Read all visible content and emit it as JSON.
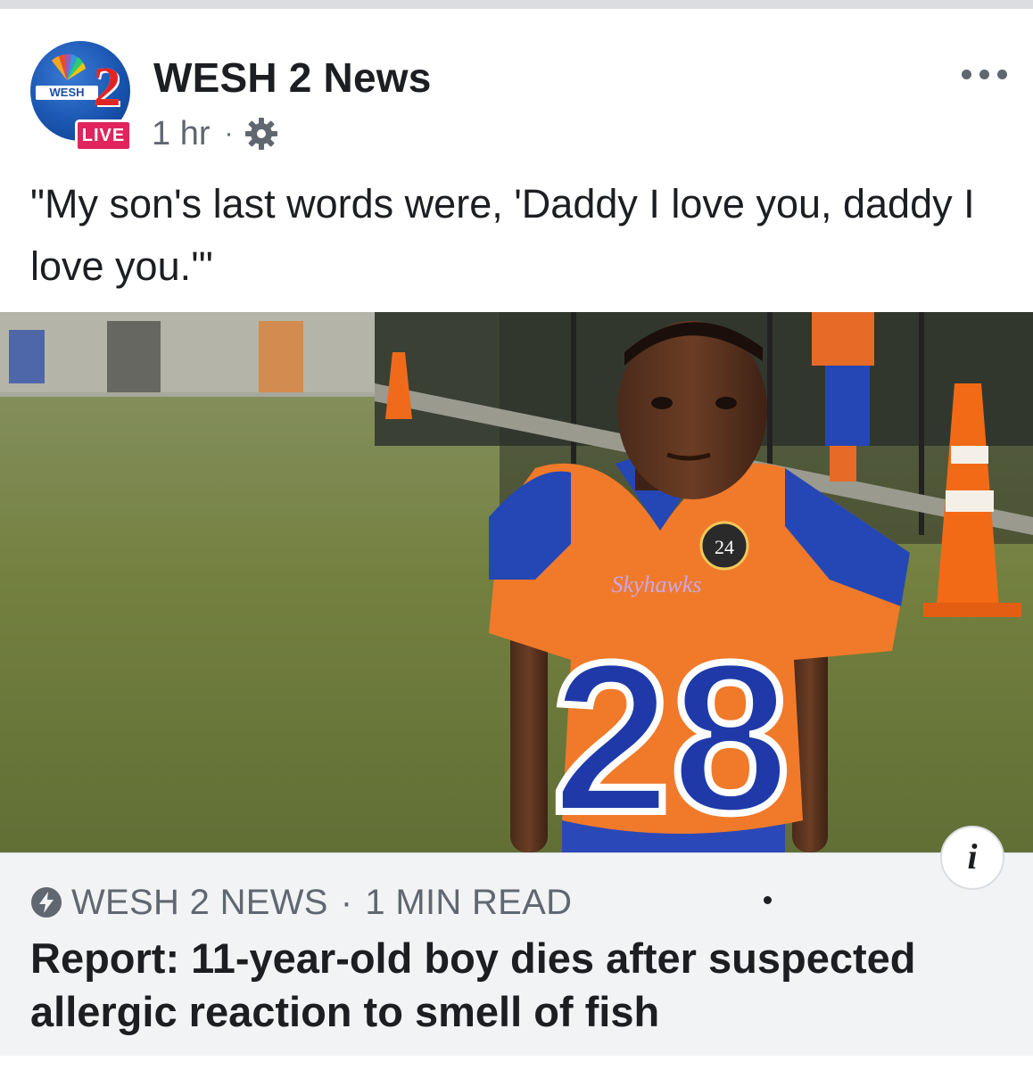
{
  "post": {
    "page_name": "WESH 2 News",
    "live_badge": "LIVE",
    "avatar_text": "WESH",
    "avatar_numeral": "2",
    "timestamp": "1 hr",
    "meta_separator": "·",
    "text": "\"My son's last words were, 'Daddy I love you, daddy I love you.'\""
  },
  "photo": {
    "jersey_number": "28",
    "jersey_team": "Skyhawks",
    "patch_number": "24"
  },
  "link_preview": {
    "source": "WESH 2 NEWS",
    "separator": "·",
    "read_time": "1 MIN READ",
    "headline": "Report: 11-year-old boy dies after suspected allergic reaction to smell of fish"
  },
  "info_button": {
    "label": "i"
  },
  "icons": {
    "more": "more-dots-icon",
    "privacy": "gear-icon",
    "instant_article": "lightning-bolt-icon",
    "info": "info-icon"
  },
  "colors": {
    "live_red": "#e0245e",
    "text_primary": "#1c1e21",
    "text_secondary": "#606770",
    "preview_bg": "#f2f3f5",
    "jersey_orange": "#f07a2a",
    "jersey_blue": "#2447b5"
  }
}
